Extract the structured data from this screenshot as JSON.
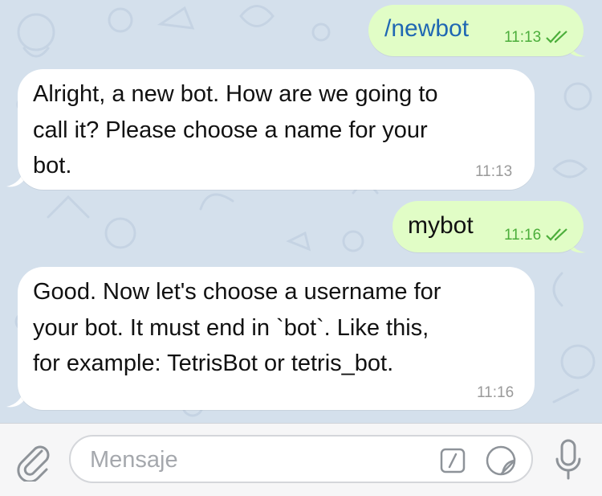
{
  "messages": [
    {
      "direction": "outgoing",
      "text": "/newbot",
      "time": "11:13",
      "is_command": true
    },
    {
      "direction": "incoming",
      "lines": [
        "Alright, a new bot. How are we going to",
        "call it? Please choose a name for your",
        "bot."
      ],
      "time": "11:13"
    },
    {
      "direction": "outgoing",
      "text": "mybot",
      "time": "11:16",
      "is_command": false
    },
    {
      "direction": "incoming",
      "lines": [
        "Good. Now let's choose a username for",
        "your bot. It must end in `bot`. Like this,",
        "for example: TetrisBot or tetris_bot."
      ],
      "time": "11:16"
    }
  ],
  "composer": {
    "placeholder": "Mensaje",
    "attach_icon": "paperclip-icon",
    "command_icon": "slash-command-icon",
    "sticker_icon": "sticker-icon",
    "mic_icon": "microphone-icon"
  },
  "colors": {
    "outgoing_bubble": "#e1fdc6",
    "incoming_bubble": "#ffffff",
    "command_text": "#1f67b3",
    "read_time": "#4cae3b",
    "wallpaper": "#d4e0ec",
    "icon_gray": "#8e9399"
  }
}
